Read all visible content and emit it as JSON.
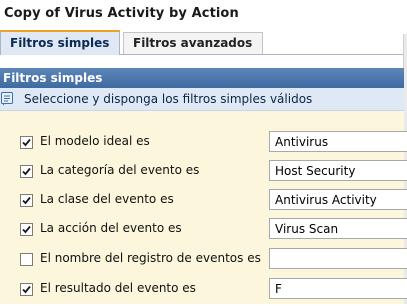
{
  "window": {
    "title": "Copy of Virus Activity by Action"
  },
  "tabs": [
    {
      "label": "Filtros simples",
      "active": true
    },
    {
      "label": "Filtros avanzados",
      "active": false
    }
  ],
  "panel": {
    "header": "Filtros simples",
    "instruction": "Seleccione y disponga los filtros simples válidos",
    "info_icon": "info-icon"
  },
  "filters": [
    {
      "label": "El modelo ideal es",
      "checked": true,
      "value": "Antivirus"
    },
    {
      "label": "La categoría del evento es",
      "checked": true,
      "value": "Host Security"
    },
    {
      "label": "La clase del evento es",
      "checked": true,
      "value": "Antivirus Activity"
    },
    {
      "label": "La acción del evento es",
      "checked": true,
      "value": "Virus Scan"
    },
    {
      "label": "El nombre del registro de eventos es",
      "checked": false,
      "value": ""
    },
    {
      "label": "El resultado del evento es",
      "checked": true,
      "value": "F"
    }
  ],
  "colors": {
    "header_bg": "#4a74aa",
    "content_bg": "#fbf6dc",
    "active_tab_accent": "#f0a020"
  }
}
